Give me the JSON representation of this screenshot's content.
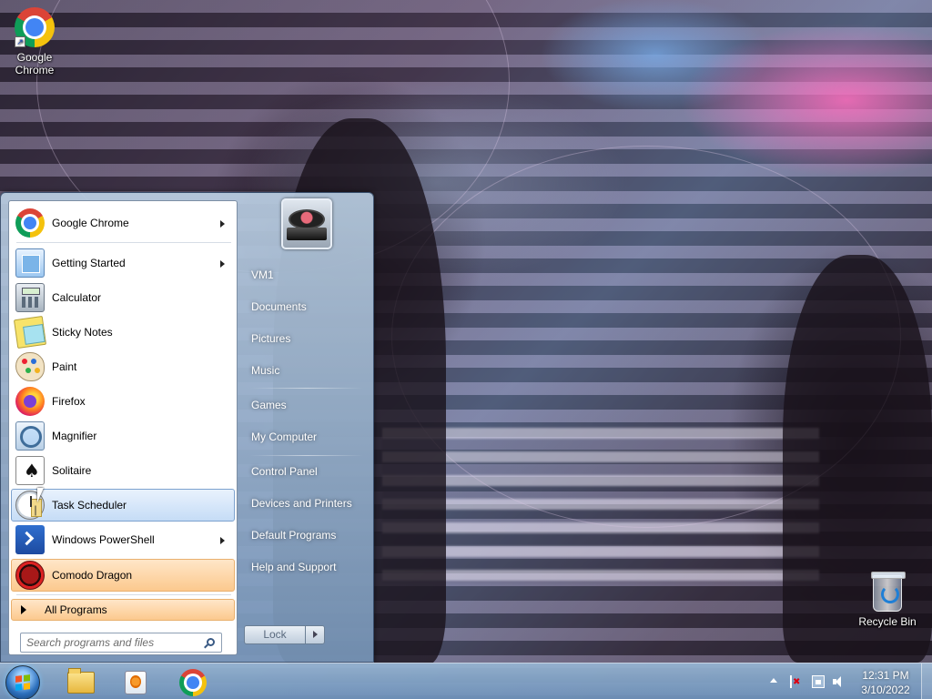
{
  "desktop": {
    "icons": [
      {
        "label": "Google Chrome",
        "icon": "chrome-icon"
      },
      {
        "label": "Recycle Bin",
        "icon": "recycle-bin-icon"
      }
    ]
  },
  "start_menu": {
    "programs": [
      {
        "label": "Google Chrome",
        "icon": "chrome-icon",
        "has_submenu": true
      },
      {
        "label": "Getting Started",
        "icon": "getting-started-icon",
        "has_submenu": true
      },
      {
        "label": "Calculator",
        "icon": "calculator-icon"
      },
      {
        "label": "Sticky Notes",
        "icon": "sticky-notes-icon"
      },
      {
        "label": "Paint",
        "icon": "paint-icon"
      },
      {
        "label": "Firefox",
        "icon": "firefox-icon"
      },
      {
        "label": "Magnifier",
        "icon": "magnifier-icon"
      },
      {
        "label": "Solitaire",
        "icon": "solitaire-icon"
      },
      {
        "label": "Task Scheduler",
        "icon": "task-scheduler-icon",
        "state": "hover"
      },
      {
        "label": "Windows PowerShell",
        "icon": "powershell-icon",
        "has_submenu": true
      },
      {
        "label": "Comodo Dragon",
        "icon": "comodo-dragon-icon",
        "state": "new"
      }
    ],
    "all_programs_label": "All Programs",
    "search_placeholder": "Search programs and files",
    "right_links": [
      {
        "label": "VM1"
      },
      {
        "label": "Documents"
      },
      {
        "label": "Pictures"
      },
      {
        "label": "Music"
      },
      {
        "label": "Games"
      },
      {
        "label": "My Computer"
      },
      {
        "label": "Control Panel"
      },
      {
        "label": "Devices and Printers"
      },
      {
        "label": "Default Programs"
      },
      {
        "label": "Help and Support"
      }
    ],
    "lock_label": "Lock"
  },
  "taskbar": {
    "pinned": [
      "windows-explorer-icon",
      "media-player-icon",
      "chrome-icon"
    ],
    "clock_time": "12:31 PM",
    "clock_date": "3/10/2022"
  },
  "colors": {
    "hover_highlight": "#c5dcf6",
    "new_program_highlight": "#fcc98e",
    "taskbar": "#6e91b9"
  }
}
